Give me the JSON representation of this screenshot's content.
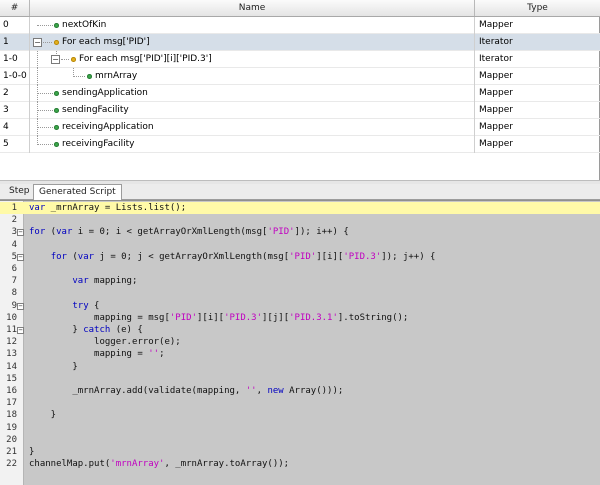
{
  "table": {
    "headers": {
      "num": "#",
      "name": "Name",
      "type": "Type"
    },
    "rows": [
      {
        "num": "0",
        "name": "nextOfKin",
        "type": "Mapper"
      },
      {
        "num": "1",
        "name": "For each msg['PID']",
        "type": "Iterator"
      },
      {
        "num": "1-0",
        "name": "For each msg['PID'][i]['PID.3']",
        "type": "Iterator"
      },
      {
        "num": "1-0-0",
        "name": "mrnArray",
        "type": "Mapper"
      },
      {
        "num": "2",
        "name": "sendingApplication",
        "type": "Mapper"
      },
      {
        "num": "3",
        "name": "sendingFacility",
        "type": "Mapper"
      },
      {
        "num": "4",
        "name": "receivingApplication",
        "type": "Mapper"
      },
      {
        "num": "5",
        "name": "receivingFacility",
        "type": "Mapper"
      }
    ]
  },
  "tabs": {
    "step": "Step",
    "script": "Generated Script"
  },
  "editor": {
    "colors": {
      "keyword": "#0000c0",
      "string": "#c000c0",
      "highlight": "#fffaa8",
      "background": "#c8c8c8"
    },
    "fold_expanded_symbol": "−",
    "lines": [
      {
        "n": "1",
        "fold": "",
        "hl": true
      },
      {
        "n": "2",
        "fold": ""
      },
      {
        "n": "3",
        "fold": "−"
      },
      {
        "n": "4",
        "fold": ""
      },
      {
        "n": "5",
        "fold": "−"
      },
      {
        "n": "6",
        "fold": ""
      },
      {
        "n": "7",
        "fold": ""
      },
      {
        "n": "8",
        "fold": ""
      },
      {
        "n": "9",
        "fold": "−"
      },
      {
        "n": "10",
        "fold": ""
      },
      {
        "n": "11",
        "fold": "−"
      },
      {
        "n": "12",
        "fold": ""
      },
      {
        "n": "13",
        "fold": ""
      },
      {
        "n": "14",
        "fold": ""
      },
      {
        "n": "15",
        "fold": ""
      },
      {
        "n": "16",
        "fold": ""
      },
      {
        "n": "17",
        "fold": ""
      },
      {
        "n": "18",
        "fold": ""
      },
      {
        "n": "19",
        "fold": ""
      },
      {
        "n": "20",
        "fold": ""
      },
      {
        "n": "21",
        "fold": ""
      },
      {
        "n": "22",
        "fold": ""
      }
    ],
    "code": {
      "l1": [
        "var",
        " _mrnArray = Lists.list();"
      ],
      "l3": [
        "for",
        " (",
        "var",
        " i = 0; i < getArrayOrXmlLength(msg[",
        "'PID'",
        "]); i++) {"
      ],
      "l5": [
        "    ",
        "for",
        " (",
        "var",
        " j = 0; j < getArrayOrXmlLength(msg[",
        "'PID'",
        "][i][",
        "'PID.3'",
        "]); j++) {"
      ],
      "l7": [
        "        ",
        "var",
        " mapping;"
      ],
      "l9": [
        "        ",
        "try",
        " {"
      ],
      "l10": [
        "            mapping = msg[",
        "'PID'",
        "][i][",
        "'PID.3'",
        "][j][",
        "'PID.3.1'",
        "].toString();"
      ],
      "l11": [
        "        } ",
        "catch",
        " (e) {"
      ],
      "l12": [
        "            logger.error(e);"
      ],
      "l13": [
        "            mapping = ",
        "''",
        ";"
      ],
      "l14": [
        "        }"
      ],
      "l16": [
        "        _mrnArray.add(validate(mapping, ",
        "''",
        ", ",
        "new",
        " Array()));"
      ],
      "l18": [
        "    }"
      ],
      "l21": [
        "}"
      ],
      "l22": [
        "channelMap.put(",
        "'mrnArray'",
        ", _mrnArray.toArray());"
      ]
    }
  }
}
